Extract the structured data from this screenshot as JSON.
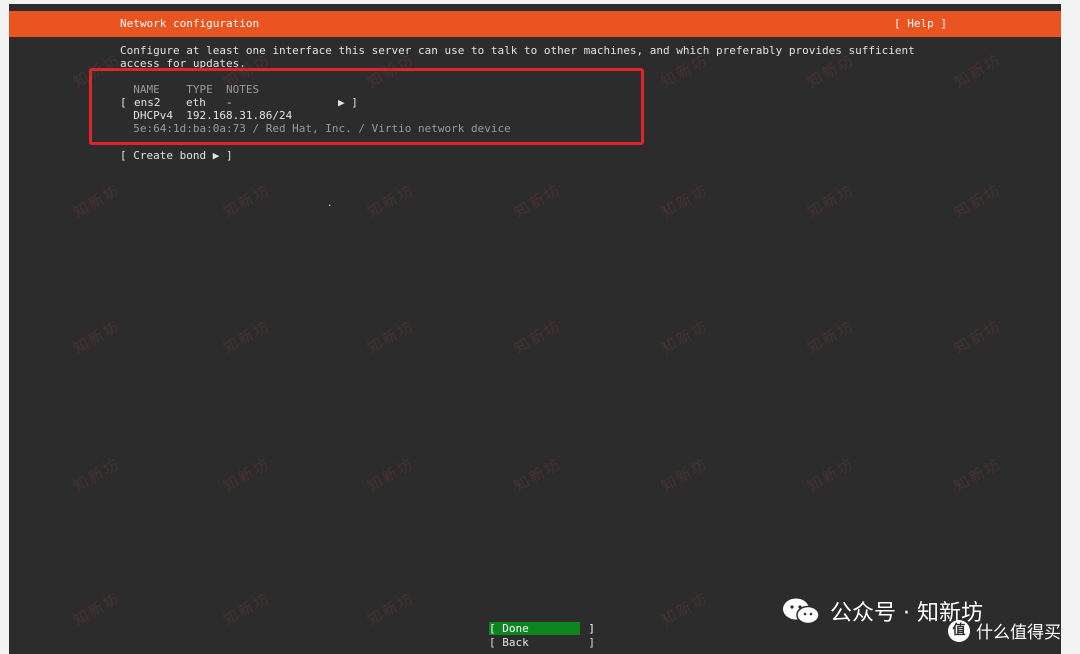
{
  "header": {
    "title": "Network configuration",
    "help": "[ Help ]"
  },
  "intro": {
    "line1": "Configure at least one interface this server can use to talk to other machines, and which preferably provides sufficient",
    "line2": "access for updates."
  },
  "table": {
    "columns": "  NAME    TYPE  NOTES",
    "row_name": "ens2",
    "row_type": "eth",
    "row_notes": "-",
    "row_open": "[",
    "row_arrow": "▶ ]",
    "dhcp": "  DHCPv4  192.168.31.86/24",
    "device": "  5e:64:1d:ba:0a:73 / Red Hat, Inc. / Virtio network device"
  },
  "create_bond": "[ Create bond ▶ ]",
  "buttons": {
    "done": "[ Done         ]",
    "back": "[ Back         ]"
  },
  "watermark_text": "知新坊",
  "brand": {
    "label": "公众号 · 知新坊",
    "footer": "什么值得买",
    "footer_icon": "值"
  },
  "colors": {
    "accent": "#e95420",
    "done": "#0e8420",
    "highlight_box": "#e0242c"
  }
}
